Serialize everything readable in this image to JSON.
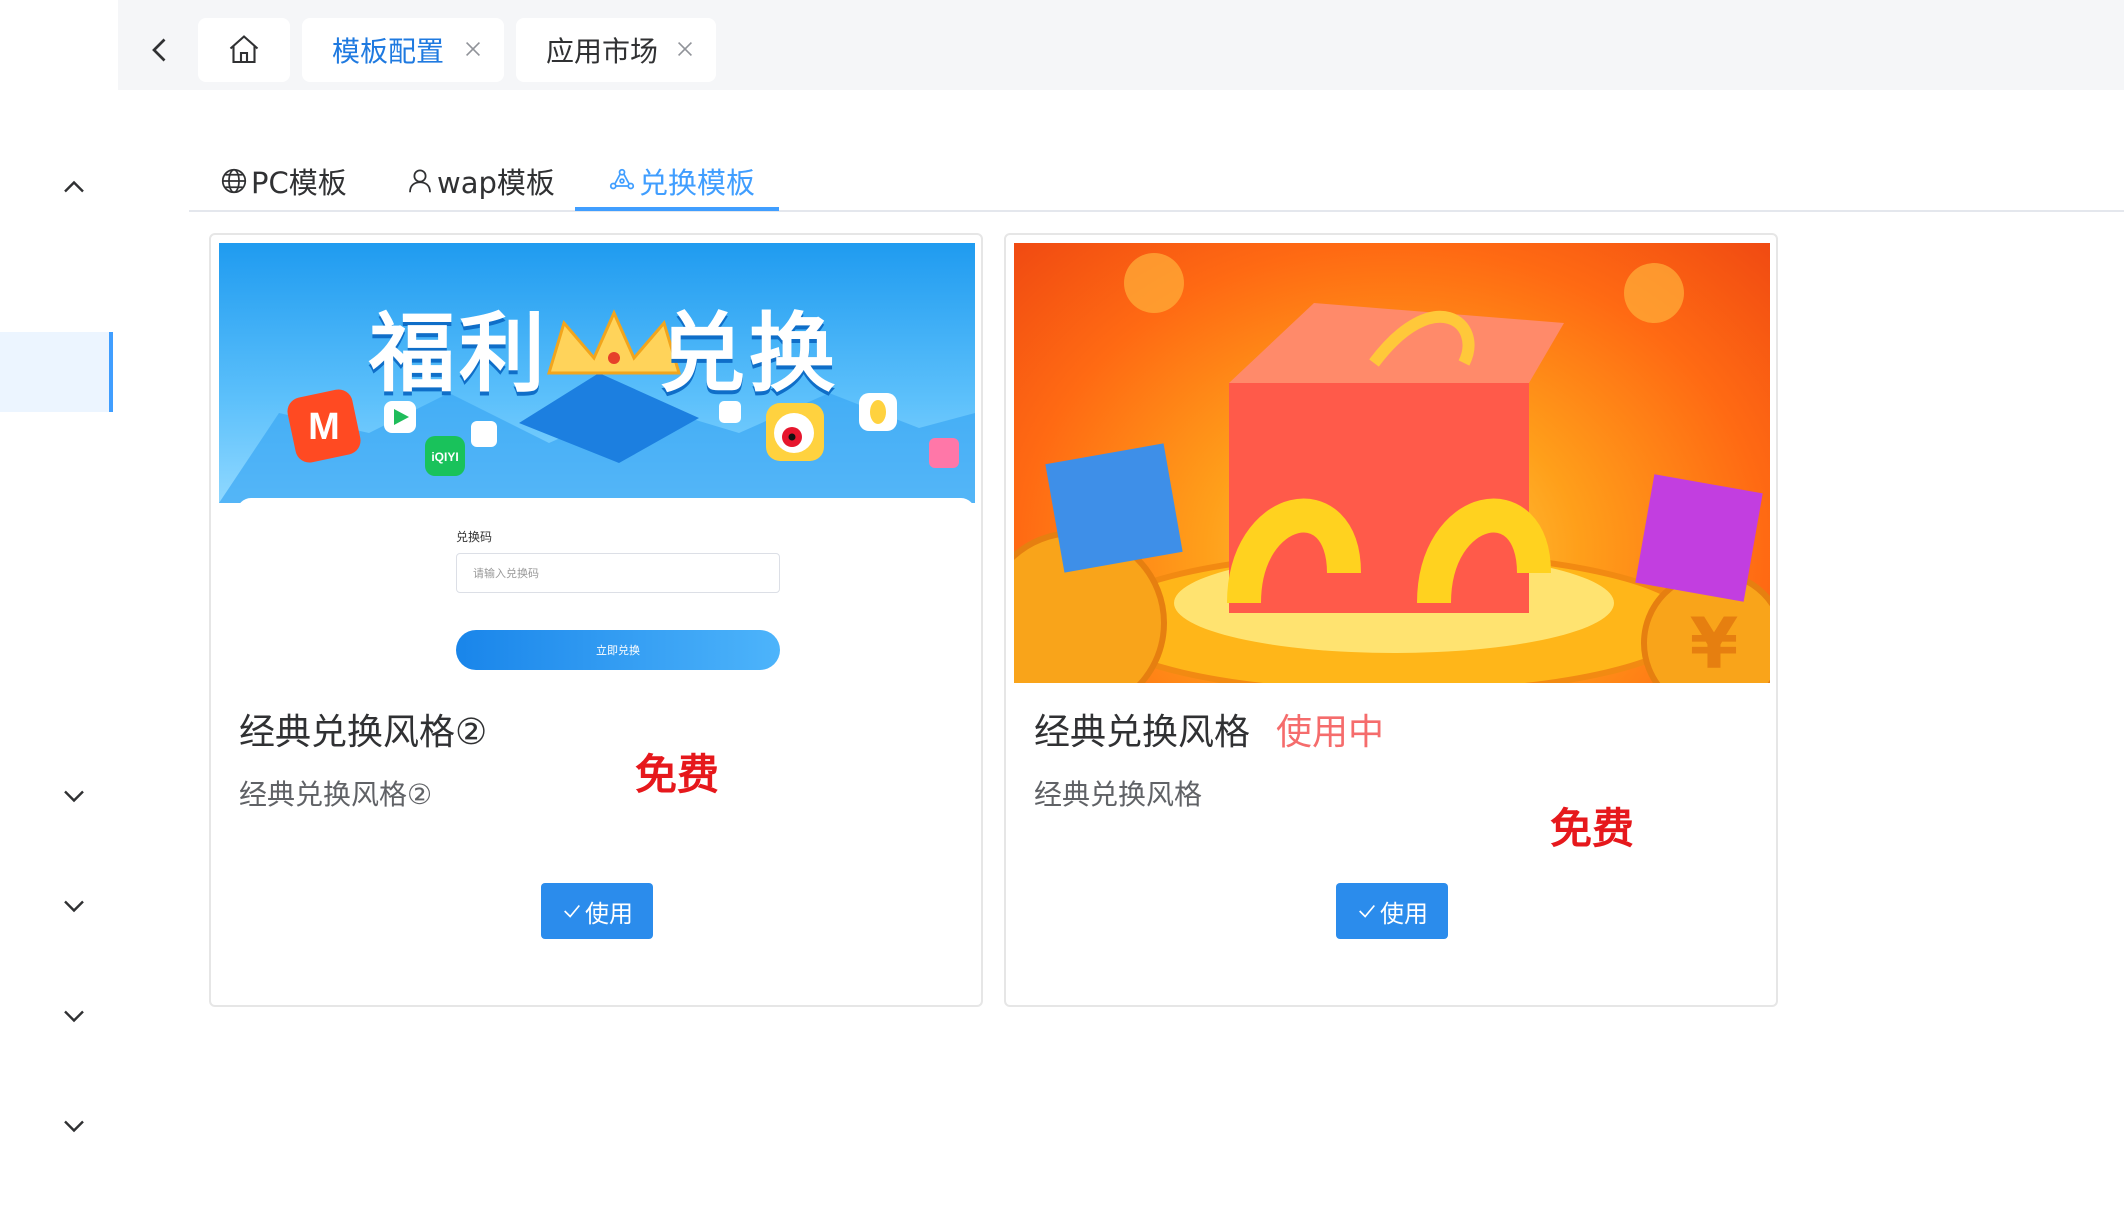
{
  "topbar": {
    "tabs": [
      {
        "label": "模板配置",
        "active": true
      },
      {
        "label": "应用市场",
        "active": false
      }
    ]
  },
  "content": {
    "tabs": [
      {
        "label": "PC模板",
        "icon": "globe-icon"
      },
      {
        "label": "wap模板",
        "icon": "user-icon"
      },
      {
        "label": "兑换模板",
        "icon": "exchange-icon",
        "active": true
      }
    ],
    "cards": [
      {
        "title": "经典兑换风格②",
        "status": "",
        "description": "经典兑换风格②",
        "price": "免费",
        "button": "使用",
        "preview": {
          "banner_title_left": "福利",
          "banner_title_right": "兑换",
          "field_label": "兑换码",
          "field_placeholder": "请输入兑换码",
          "submit_label": "立即兑换"
        }
      },
      {
        "title": "经典兑换风格",
        "status": "使用中",
        "description": "经典兑换风格",
        "price": "免费",
        "button": "使用"
      }
    ]
  },
  "colors": {
    "primary": "#409eff",
    "button": "#2b8cec",
    "in_use": "#f56c6c",
    "price": "#e6181c"
  }
}
